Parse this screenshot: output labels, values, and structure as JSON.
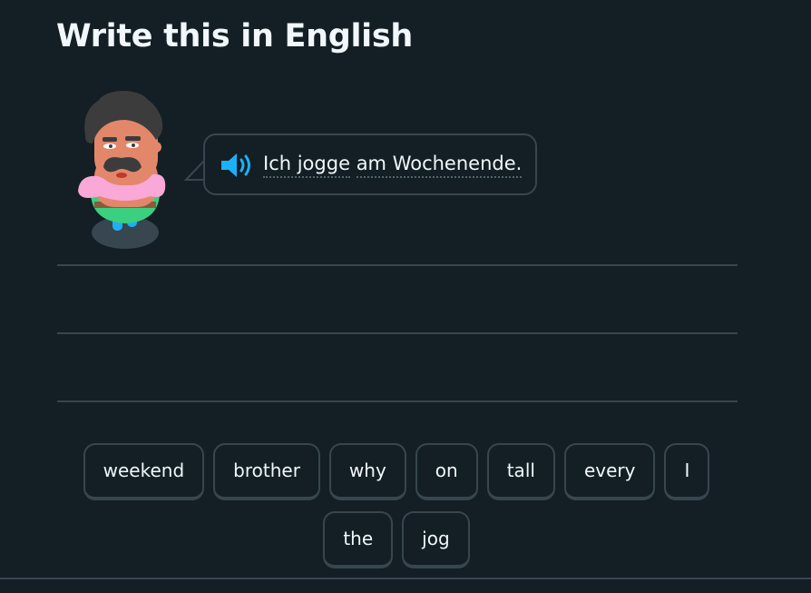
{
  "challenge": {
    "title": "Write this in English",
    "sentence_words": [
      "Ich jogge",
      "am Wochenende."
    ],
    "audio_icon": "speaker-icon",
    "character_icon": "character-avatar"
  },
  "word_bank": {
    "row1": [
      "weekend",
      "brother",
      "why",
      "on",
      "tall",
      "every",
      "I"
    ],
    "row2": [
      "the",
      "jog"
    ]
  },
  "colors": {
    "background": "#131f24",
    "border": "#37464f",
    "text": "#f1f7fb",
    "accent": "#1cb0f6"
  }
}
